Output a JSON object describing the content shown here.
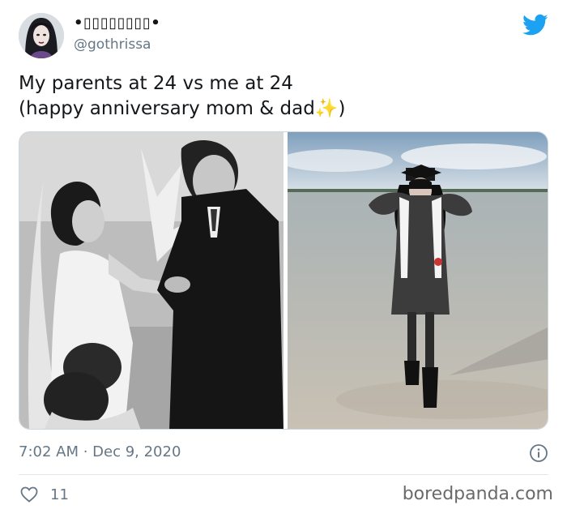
{
  "tweet": {
    "display_name": "•▯▯▯▯▯▯▯▯•",
    "handle": "@gothrissa",
    "text": "My parents at 24  vs me at 24\n(happy anniversary mom & dad✨)",
    "timestamp": "7:02 AM · Dec 9, 2020",
    "likes": "11"
  },
  "icons": {
    "logo": "twitter-bird-icon",
    "info": "info-icon",
    "like": "heart-icon"
  },
  "colors": {
    "brand": "#1da1f2",
    "secondary_text": "#657786",
    "divider": "#e1e8ed"
  },
  "watermark": "boredpanda.com"
}
